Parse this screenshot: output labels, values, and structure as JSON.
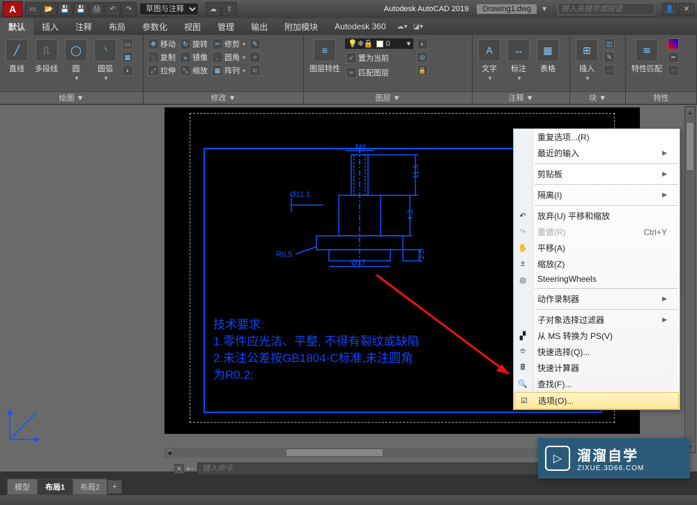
{
  "title": {
    "app": "A",
    "product": "Autodesk AutoCAD 2019",
    "doc": "Drawing1.dwg",
    "search_ph": "键入关键字或短语",
    "workspace": "草图与注释"
  },
  "menu": {
    "tabs": [
      "默认",
      "插入",
      "注释",
      "布局",
      "参数化",
      "视图",
      "管理",
      "输出",
      "附加模块",
      "Autodesk 360"
    ]
  },
  "ribbon": {
    "panel_draw": {
      "title": "绘图",
      "line": "直线",
      "pline": "多段线",
      "circle": "圆",
      "arc": "圆弧"
    },
    "panel_mod": {
      "title": "修改",
      "move": "移动",
      "copy": "复制",
      "stretch": "拉伸",
      "rotate": "旋转",
      "mirror": "镜像",
      "scale": "缩放",
      "trim": "修剪",
      "fillet": "圆角",
      "array": "阵列"
    },
    "panel_layer": {
      "title": "图层",
      "props": "图层特性",
      "layer0": "0",
      "setcur": "置为当前",
      "match": "匹配图层"
    },
    "panel_ann": {
      "title": "注释",
      "text": "文字",
      "dim": "标注",
      "table": "表格"
    },
    "panel_block": {
      "title": "块",
      "insert": "插入"
    },
    "panel_prop": {
      "title": "特性",
      "pm": "特性匹配"
    }
  },
  "drawing_labels": {
    "m6": "M6",
    "d11": "Ø11.1",
    "r05": "R0.5",
    "d17": "Ø17",
    "h0": "11.6",
    "h1": "4.3",
    "h3": "2.5"
  },
  "tech": {
    "t0": "技术要求:",
    "t1": "1.零件应光洁、平整, 不得有裂纹或缺陷",
    "t2": "2.未注公差按GB1804-C标准,未注圆角",
    "t3": "为R0.2;"
  },
  "ctx": {
    "repeat": "重复选项...(R)",
    "recent": "最近的输入",
    "clipboard": "剪贴板",
    "isolate": "隔离(I)",
    "undo": "放弃(U) 平移和缩放",
    "redo": "重做(R)",
    "redo_sc": "Ctrl+Y",
    "pan": "平移(A)",
    "zoom": "缩放(Z)",
    "sw": "SteeringWheels",
    "actrec": "动作录制器",
    "subfilter": "子对象选择过滤器",
    "msps": "从 MS 转换为 PS(V)",
    "qsel": "快速选择(Q)...",
    "qcalc": "快速计算器",
    "find": "查找(F)...",
    "options": "选项(O)..."
  },
  "cmd": {
    "placeholder": "键入命令"
  },
  "layouts": {
    "model": "模型",
    "l1": "布局1",
    "l2": "布局2"
  },
  "watermark": {
    "cn": "溜溜自学",
    "en": "ZIXUE.3D66.COM"
  }
}
